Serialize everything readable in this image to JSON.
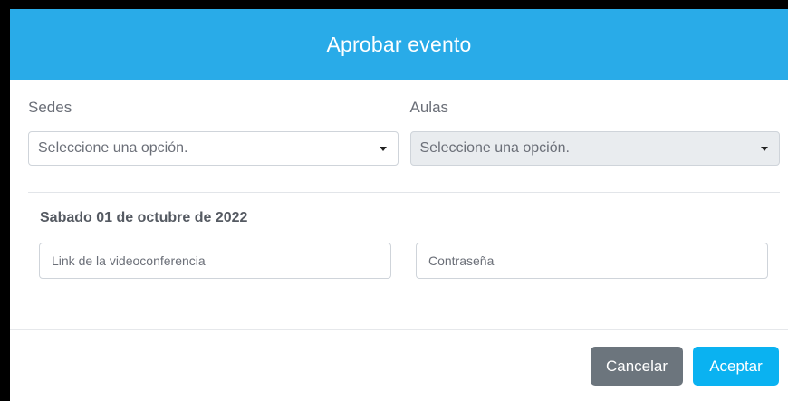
{
  "modal": {
    "title": "Aprobar evento",
    "sedes": {
      "label": "Sedes",
      "selected": "Seleccione una opción."
    },
    "aulas": {
      "label": "Aulas",
      "selected": "Seleccione una opción."
    },
    "date": "Sabado 01 de octubre de 2022",
    "link_input": {
      "placeholder": "Link de la videoconferencia",
      "value": ""
    },
    "password_input": {
      "placeholder": "Contraseña",
      "value": ""
    },
    "footer": {
      "cancel_label": "Cancelar",
      "accept_label": "Aceptar"
    }
  },
  "colors": {
    "header": "#29abe8",
    "cancel": "#6c757d",
    "accept": "#0ab2f1"
  }
}
